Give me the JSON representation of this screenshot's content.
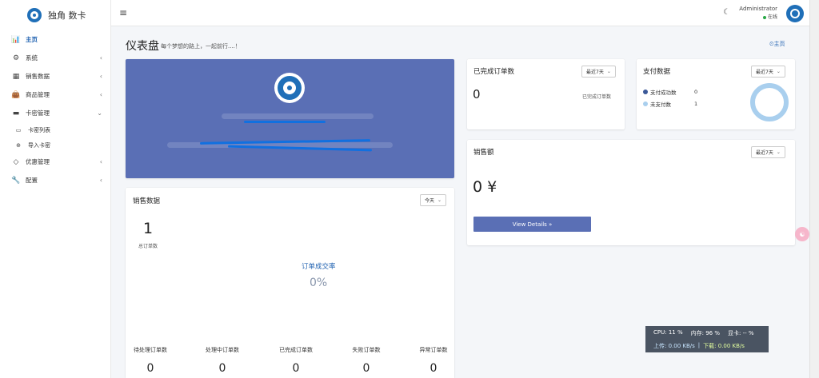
{
  "brand": {
    "name": "独角 数卡"
  },
  "sidebar": {
    "items": [
      {
        "label": "主页",
        "icon": "bar-chart-icon",
        "glyph": "📊"
      },
      {
        "label": "系统",
        "icon": "gear-icon",
        "glyph": "⚙"
      },
      {
        "label": "销售数据",
        "icon": "table-icon",
        "glyph": "▦"
      },
      {
        "label": "商品管理",
        "icon": "bag-icon",
        "glyph": "👜"
      },
      {
        "label": "卡密管理",
        "icon": "card-icon",
        "glyph": "▬"
      },
      {
        "label": "优惠管理",
        "icon": "diamond-icon",
        "glyph": "◇"
      },
      {
        "label": "配置",
        "icon": "wrench-icon",
        "glyph": "🔧"
      }
    ],
    "sub_items": [
      {
        "label": "卡密列表",
        "icon": "card-icon",
        "glyph": "▭"
      },
      {
        "label": "导入卡密",
        "icon": "plus-circle-icon",
        "glyph": "⊕"
      }
    ]
  },
  "topbar": {
    "user_name": "Administrator",
    "user_status": "在线"
  },
  "page": {
    "title": "仪表盘",
    "subtitle": "每个梦想的路上，一起前行....！",
    "home_link": "主页"
  },
  "completed_orders": {
    "title": "已完成订单数",
    "range": "最近7天",
    "value": "0",
    "label": "已完成订单数"
  },
  "payment": {
    "title": "支付数据",
    "range": "最近7天",
    "legend": [
      {
        "label": "支付成功数",
        "value": "0",
        "color": "#3b5998"
      },
      {
        "label": "未支付数",
        "value": "1",
        "color": "#a9cfee"
      }
    ]
  },
  "sales_amount": {
    "title": "销售额",
    "range": "最近7天",
    "value": "0 ¥",
    "button": "View Details »"
  },
  "sales_data": {
    "title": "销售数据",
    "range": "今天",
    "total_value": "1",
    "total_label": "总订单数",
    "rate_title": "订单成交率",
    "rate_value": "0%",
    "stats": [
      {
        "label": "待处理订单数",
        "value": "0"
      },
      {
        "label": "处理中订单数",
        "value": "0"
      },
      {
        "label": "已完成订单数",
        "value": "0"
      },
      {
        "label": "失败订单数",
        "value": "0"
      },
      {
        "label": "异常订单数",
        "value": "0"
      }
    ]
  },
  "sysmon": {
    "cpu": "CPU: 11 %",
    "mem": "内存: 96 %",
    "gpu": "显卡: -- %",
    "up": "上传: 0.00 KB/s",
    "sep": "|",
    "down": "下载: 0.00 KB/s"
  },
  "colors": {
    "accent": "#2062b1",
    "banner": "#5a6fb5"
  }
}
